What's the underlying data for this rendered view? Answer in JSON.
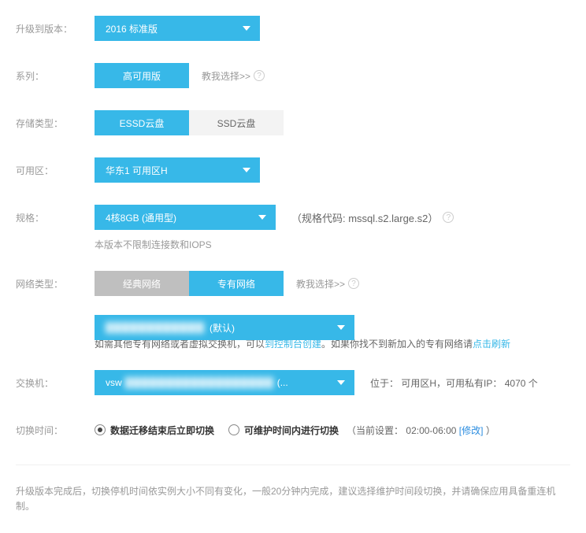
{
  "labels": {
    "version": "升级到版本：",
    "series": "系列：",
    "storage": "存储类型：",
    "zone": "可用区：",
    "spec": "规格：",
    "network": "网络类型：",
    "vswitch": "交换机：",
    "switchTime": "切换时间："
  },
  "version": {
    "selected": "2016 标准版"
  },
  "series": {
    "selected": "高可用版",
    "helpText": "教我选择>>"
  },
  "storage": {
    "options": [
      "ESSD云盘",
      "SSD云盘"
    ],
    "selected": 0
  },
  "zone": {
    "selected": "华东1 可用区H"
  },
  "spec": {
    "selected": "4核8GB (通用型)",
    "codeLabel": "（规格代码: mssql.s2.large.s2）",
    "note": "本版本不限制连接数和IOPS"
  },
  "network": {
    "options": [
      "经典网络",
      "专有网络"
    ],
    "selected": 1,
    "helpText": "教我选择>>",
    "vpcSuffix": "(默认)",
    "descPrefix": "如需其他专有网络或者虚拟交换机，可以",
    "link1": "到控制台创建",
    "descMid": "。如果你找不到新加入的专有网络请",
    "link2": "点击刷新"
  },
  "vswitch": {
    "prefix": "vsw",
    "displaySuffix": "(...",
    "locPrefix": "位于：",
    "locZone": "可用区H",
    "ipLabel": "，可用私有IP：",
    "ipCount": "4070 个"
  },
  "switchTime": {
    "opt1": "数据迁移结束后立即切换",
    "opt2": "可维护时间内进行切换",
    "suffix": "（当前设置：",
    "window": "02:00-06:00",
    "modify": "[修改]",
    "close": "）"
  },
  "footer": "升级版本完成后，切换停机时间依实例大小不同有变化，一般20分钟内完成，建议选择维护时间段切换，并请确保应用具备重连机制。"
}
